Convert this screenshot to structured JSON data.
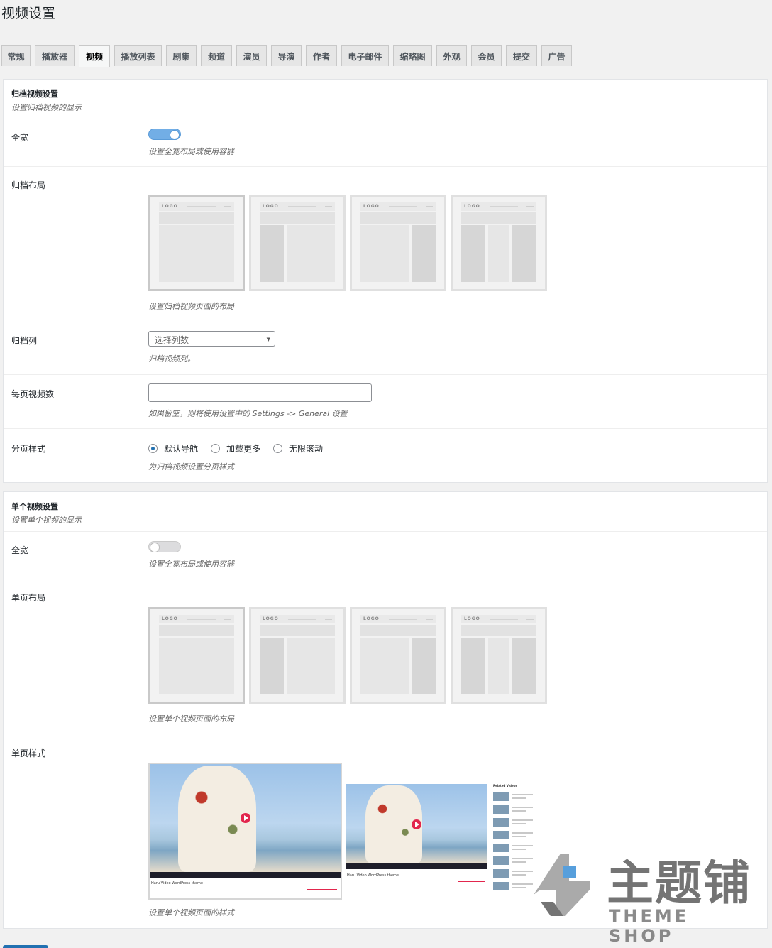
{
  "page_title": "视频设置",
  "tabs": [
    "常规",
    "播放器",
    "视频",
    "播放列表",
    "剧集",
    "频道",
    "演员",
    "导演",
    "作者",
    "电子邮件",
    "缩略图",
    "外观",
    "会员",
    "提交",
    "广告"
  ],
  "active_tab": "视频",
  "archive": {
    "title": "归档视频设置",
    "desc": "设置归档视频的显示",
    "fullwidth": {
      "label": "全宽",
      "enabled": true,
      "desc": "设置全宽布局或使用容器"
    },
    "layout": {
      "label": "归档布局",
      "desc": "设置归档视频页面的布局",
      "options": [
        "full-width",
        "left-sidebar",
        "right-sidebar",
        "both-sidebars"
      ],
      "selected": "full-width",
      "logo_text": "LOGO"
    },
    "columns": {
      "label": "归档列",
      "placeholder": "选择列数",
      "desc": "归档视频列。"
    },
    "per_page": {
      "label": "每页视频数",
      "value": "",
      "desc": "如果留空，则将使用设置中的 Settings -> General 设置"
    },
    "pagination": {
      "label": "分页样式",
      "options": [
        "默认导航",
        "加载更多",
        "无限滚动"
      ],
      "selected": "默认导航",
      "desc": "为归档视频设置分页样式"
    }
  },
  "single": {
    "title": "单个视频设置",
    "desc": "设置单个视频的显示",
    "fullwidth": {
      "label": "全宽",
      "enabled": false,
      "desc": "设置全宽布局或使用容器"
    },
    "layout": {
      "label": "单页布局",
      "desc": "设置单个视频页面的布局",
      "options": [
        "full-width",
        "left-sidebar",
        "right-sidebar",
        "both-sidebars"
      ],
      "selected": "full-width",
      "logo_text": "LOGO"
    },
    "style": {
      "label": "单页样式",
      "desc": "设置单个视频页面的样式",
      "video_caption": "Haru Video WordPress theme",
      "related_title": "Related Videos",
      "selected": "style-1"
    }
  },
  "watermark": {
    "brand": "主题铺",
    "sub": "THEME SHOP"
  },
  "colors": {
    "accent": "#2271b1",
    "toggle_on": "#72aee6",
    "play": "#e2264d"
  }
}
